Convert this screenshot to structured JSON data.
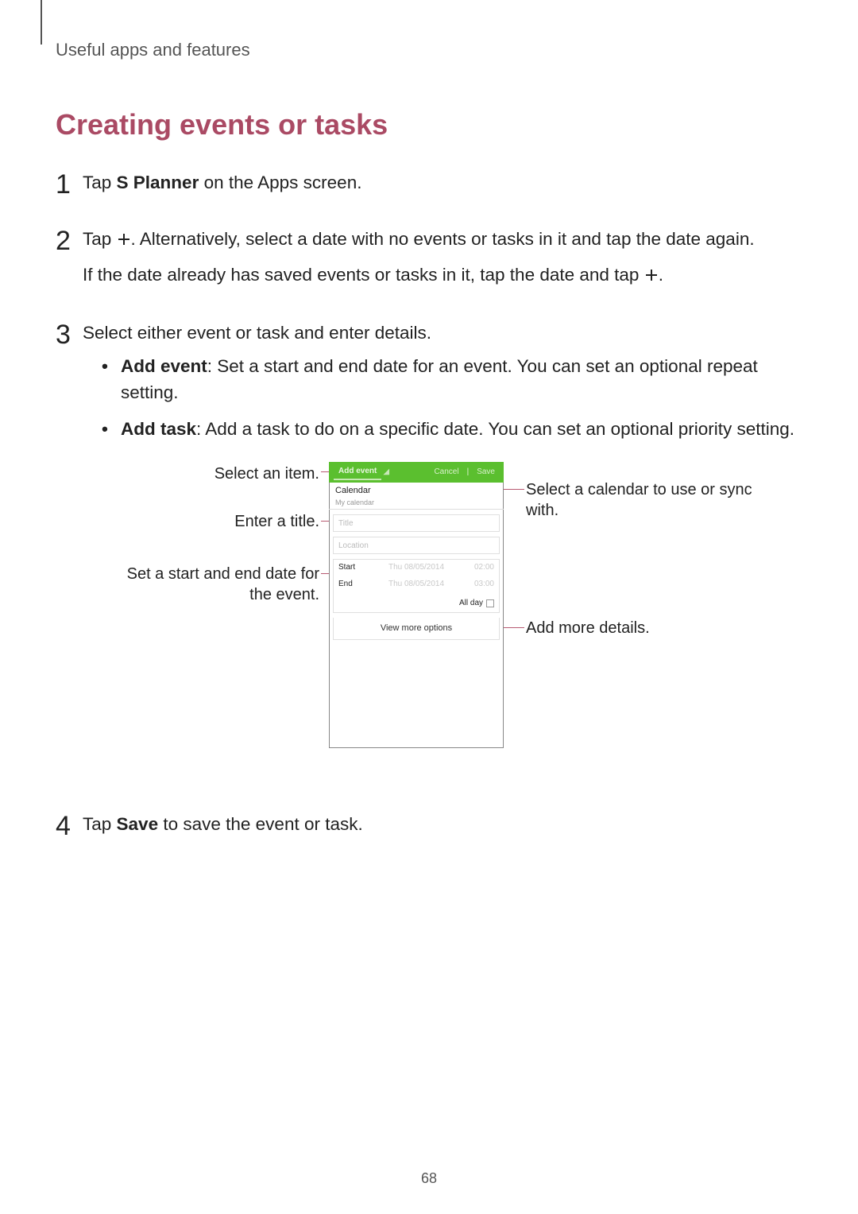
{
  "header": {
    "breadcrumb": "Useful apps and features"
  },
  "title": "Creating events or tasks",
  "steps": {
    "s1": {
      "num": "1",
      "pre": "Tap ",
      "app": "S Planner",
      "post": " on the Apps screen."
    },
    "s2": {
      "num": "2",
      "p1_pre": "Tap ",
      "p1_post": ". Alternatively, select a date with no events or tasks in it and tap the date again.",
      "p2_pre": "If the date already has saved events or tasks in it, tap the date and tap ",
      "p2_post": "."
    },
    "s3": {
      "num": "3",
      "lead": "Select either event or task and enter details.",
      "bullet1_label": "Add event",
      "bullet1_text": ": Set a start and end date for an event. You can set an optional repeat setting.",
      "bullet2_label": "Add task",
      "bullet2_text": ": Add a task to do on a specific date. You can set an optional priority setting."
    },
    "s4": {
      "num": "4",
      "pre": "Tap ",
      "btn": "Save",
      "post": " to save the event or task."
    }
  },
  "callouts": {
    "select_item": "Select an item.",
    "enter_title": "Enter a title.",
    "set_dates": "Set a start and end date for the event.",
    "select_calendar": "Select a calendar to use or sync with.",
    "add_more": "Add more details."
  },
  "phone": {
    "tab_addevent": "Add event",
    "btn_cancel": "Cancel",
    "btn_save": "Save",
    "calendar_label": "Calendar",
    "calendar_value": "My calendar",
    "title_placeholder": "Title",
    "location_placeholder": "Location",
    "start_label": "Start",
    "end_label": "End",
    "start_date": "Thu 08/05/2014",
    "start_time": "02:00",
    "end_date": "Thu 08/05/2014",
    "end_time": "03:00",
    "allday_label": "All day",
    "view_more": "View more options"
  },
  "page_number": "68"
}
